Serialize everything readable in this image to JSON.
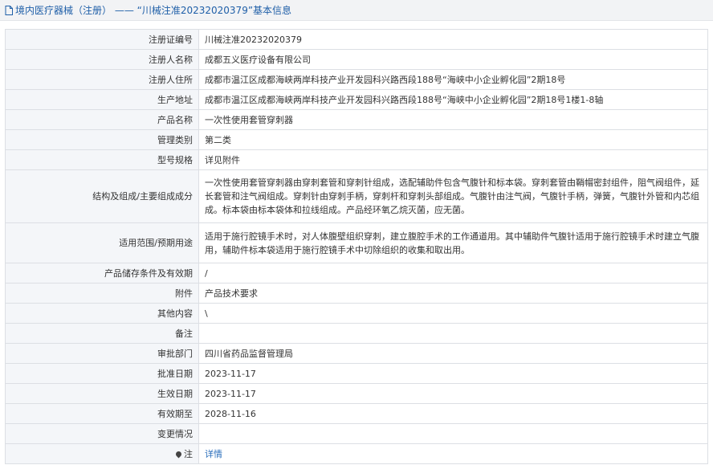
{
  "header": {
    "title": "境内医疗器械（注册） —— “川械注准20232020379”基本信息"
  },
  "rows": [
    {
      "label": "注册证编号",
      "value": "川械注准20232020379"
    },
    {
      "label": "注册人名称",
      "value": "成都五义医疗设备有限公司"
    },
    {
      "label": "注册人住所",
      "value": "成都市温江区成都海峡两岸科技产业开发园科兴路西段188号“海峡中小企业孵化园”2期18号"
    },
    {
      "label": "生产地址",
      "value": "成都市温江区成都海峡两岸科技产业开发园科兴路西段188号“海峡中小企业孵化园”2期18号1楼1-8轴"
    },
    {
      "label": "产品名称",
      "value": "一次性使用套管穿刺器"
    },
    {
      "label": "管理类别",
      "value": "第二类"
    },
    {
      "label": "型号规格",
      "value": "详见附件"
    },
    {
      "label": "结构及组成/主要组成成分",
      "value": "一次性使用套管穿刺器由穿刺套管和穿刺针组成，选配辅助件包含气腹针和标本袋。穿刺套管由鞘帽密封组件，阻气阀组件，延长套管和注气阀组成。穿刺针由穿刺手柄，穿刺杆和穿刺头部组成。气腹针由注气阀，气腹针手柄，弹簧，气腹针外管和内芯组成。标本袋由标本袋体和拉线组成。产品经环氧乙烷灭菌，应无菌。"
    },
    {
      "label": "适用范围/预期用途",
      "value": "适用于施行腔镜手术时，对人体腹壁组织穿刺，建立腹腔手术的工作通道用。其中辅助件气腹针适用于施行腔镜手术时建立气腹用，辅助件标本袋适用于施行腔镜手术中切除组织的收集和取出用。"
    },
    {
      "label": "产品储存条件及有效期",
      "value": "/"
    },
    {
      "label": "附件",
      "value": "产品技术要求"
    },
    {
      "label": "其他内容",
      "value": "\\"
    },
    {
      "label": "备注",
      "value": ""
    },
    {
      "label": "审批部门",
      "value": "四川省药品监督管理局"
    },
    {
      "label": "批准日期",
      "value": "2023-11-17"
    },
    {
      "label": "生效日期",
      "value": "2023-11-17"
    },
    {
      "label": "有效期至",
      "value": "2028-11-16"
    },
    {
      "label": "变更情况",
      "value": ""
    },
    {
      "label": "注",
      "value": "详情"
    }
  ]
}
